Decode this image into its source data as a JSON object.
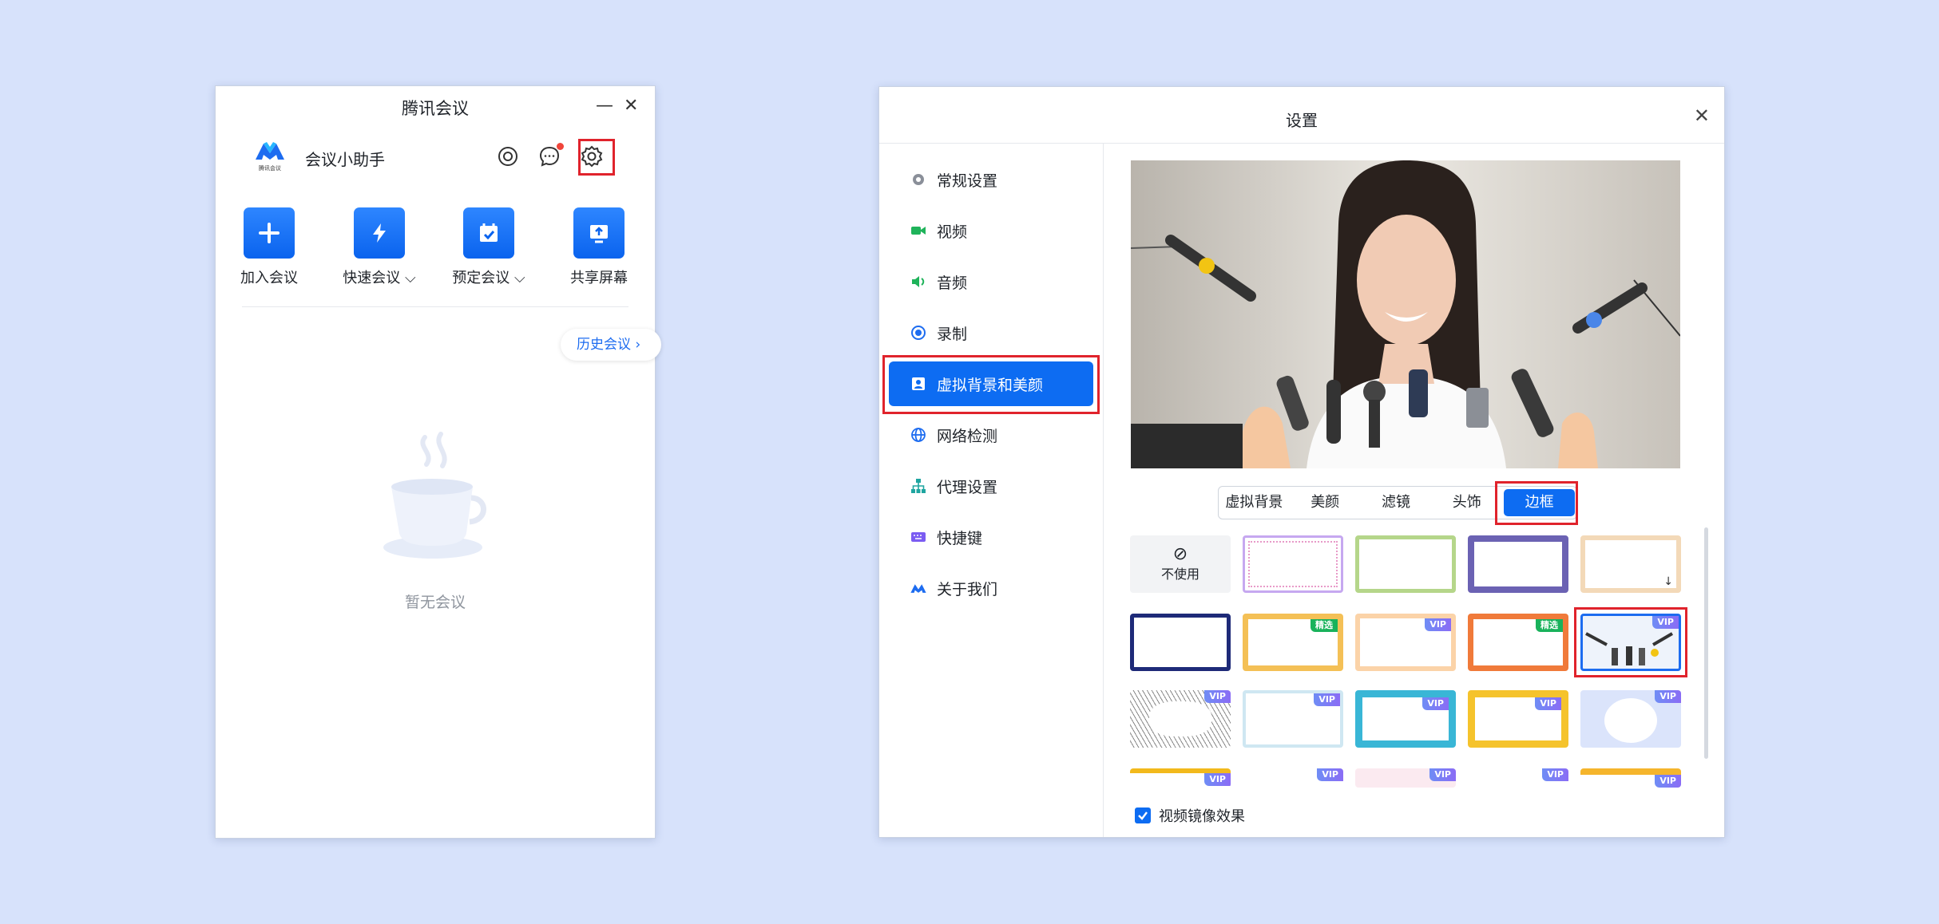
{
  "main_window": {
    "title": "腾讯会议",
    "minimize_glyph": "—",
    "close_glyph": "✕",
    "logo_caption": "腾讯会议",
    "assistant_name": "会议小助手",
    "actions": [
      {
        "label": "加入会议",
        "icon": "plus-icon"
      },
      {
        "label": "快速会议",
        "icon": "lightning-icon"
      },
      {
        "label": "预定会议",
        "icon": "calendar-icon"
      },
      {
        "label": "共享屏幕",
        "icon": "share-screen-icon"
      }
    ],
    "history_label": "历史会议",
    "empty_text": "暂无会议"
  },
  "settings": {
    "title": "设置",
    "close_glyph": "✕",
    "nav": [
      {
        "label": "常规设置",
        "icon": "gear-icon"
      },
      {
        "label": "视频",
        "icon": "camera-icon"
      },
      {
        "label": "音频",
        "icon": "speaker-icon"
      },
      {
        "label": "录制",
        "icon": "record-icon"
      },
      {
        "label": "虚拟背景和美颜",
        "icon": "portrait-icon"
      },
      {
        "label": "网络检测",
        "icon": "globe-icon"
      },
      {
        "label": "代理设置",
        "icon": "network-tree-icon"
      },
      {
        "label": "快捷键",
        "icon": "keyboard-icon"
      },
      {
        "label": "关于我们",
        "icon": "logo-icon"
      }
    ],
    "active_nav": "虚拟背景和美颜",
    "tabs": [
      "虚拟背景",
      "美颜",
      "滤镜",
      "头饰",
      "边框"
    ],
    "active_tab": "边框",
    "none_label": "不使用",
    "badges": {
      "vip": "VIP",
      "pick": "精选"
    },
    "mirror_label": "视频镜像效果",
    "mirror_checked": true
  },
  "colors": {
    "accent": "#0d6cf2",
    "highlight": "#e0232c",
    "background": "#d7e2fb"
  }
}
